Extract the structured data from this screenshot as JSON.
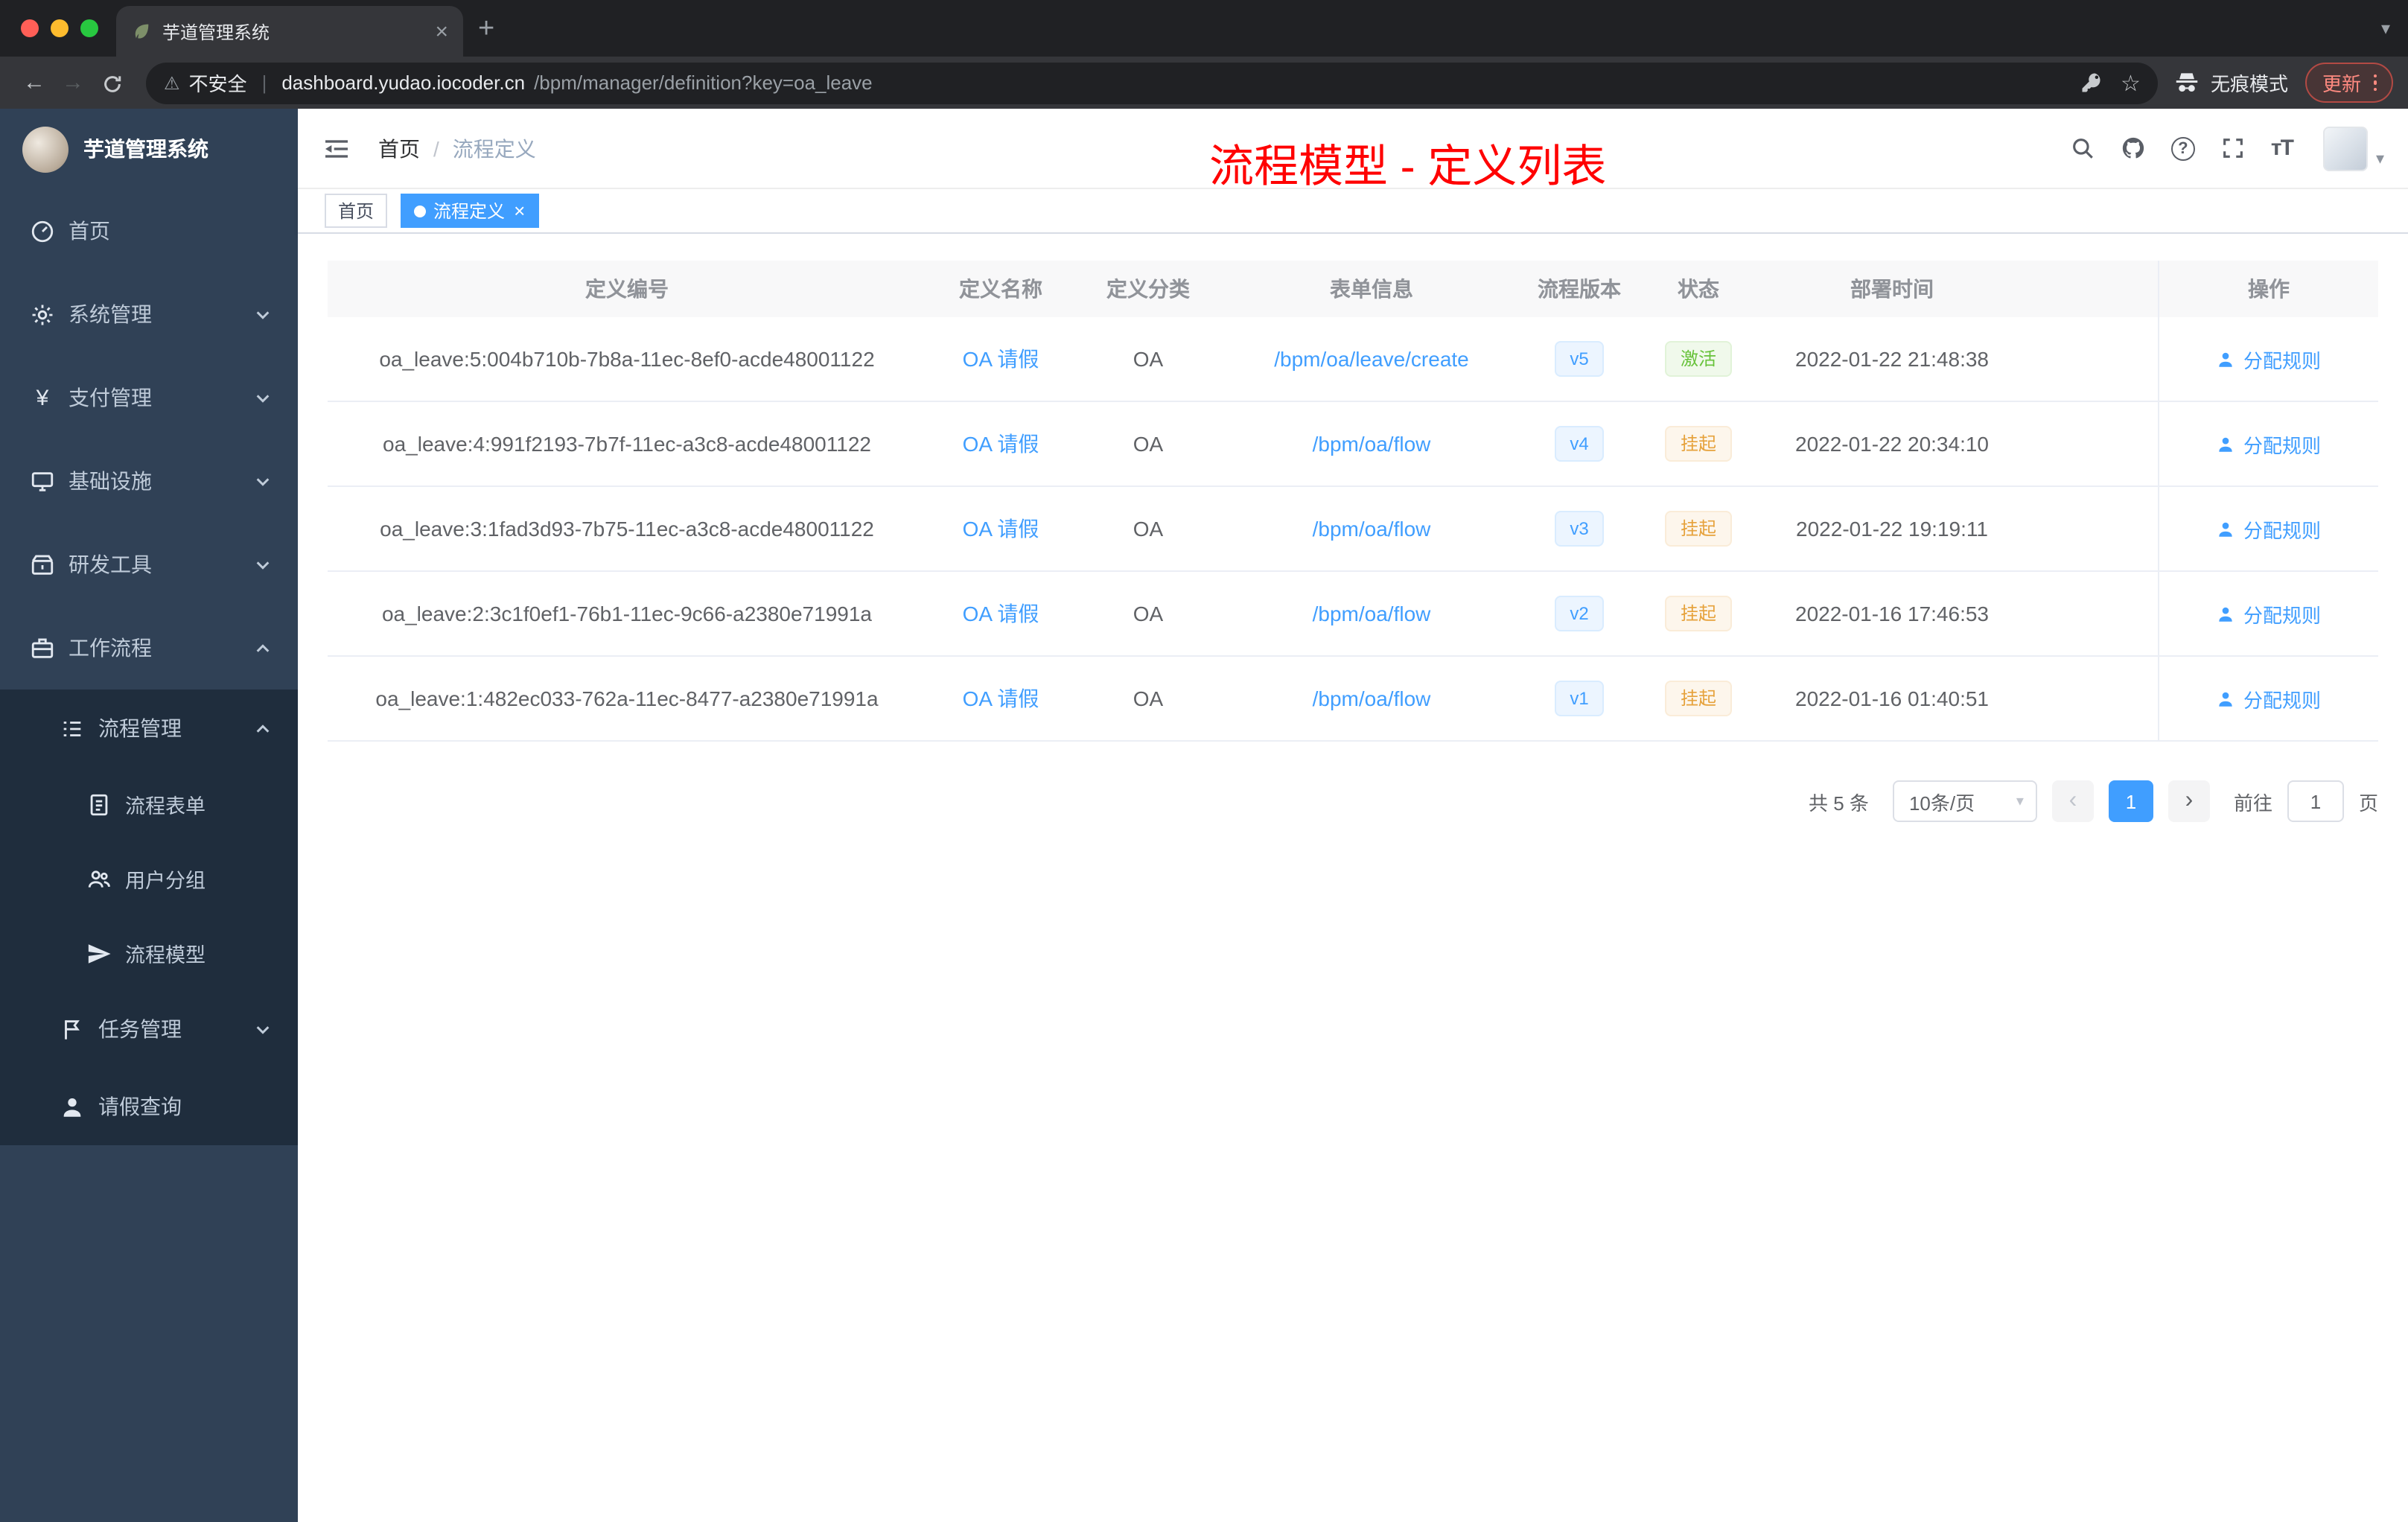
{
  "browser": {
    "tab_title": "芋道管理系统",
    "security_label": "不安全",
    "url_host": "dashboard.yudao.iocoder.cn",
    "url_path": "/bpm/manager/definition?key=oa_leave",
    "incognito_label": "无痕模式",
    "update_label": "更新"
  },
  "sidebar": {
    "brand": "芋道管理系统",
    "items": [
      {
        "label": "首页",
        "icon": "dashboard-icon",
        "chevron": ""
      },
      {
        "label": "系统管理",
        "icon": "gear-icon",
        "chevron": "down"
      },
      {
        "label": "支付管理",
        "icon": "yen-icon",
        "chevron": "down"
      },
      {
        "label": "基础设施",
        "icon": "monitor-icon",
        "chevron": "down"
      },
      {
        "label": "研发工具",
        "icon": "toolbox-icon",
        "chevron": "down"
      },
      {
        "label": "工作流程",
        "icon": "briefcase-icon",
        "chevron": "up"
      },
      {
        "label": "流程管理",
        "icon": "list-icon",
        "chevron": "up"
      },
      {
        "label": "流程表单",
        "icon": "form-icon",
        "chevron": ""
      },
      {
        "label": "用户分组",
        "icon": "users-icon",
        "chevron": ""
      },
      {
        "label": "流程模型",
        "icon": "send-icon",
        "chevron": ""
      },
      {
        "label": "任务管理",
        "icon": "flag-icon",
        "chevron": "down"
      },
      {
        "label": "请假查询",
        "icon": "user-icon",
        "chevron": ""
      }
    ]
  },
  "header": {
    "breadcrumb_home": "首页",
    "breadcrumb_sep": "/",
    "breadcrumb_current": "流程定义",
    "annotation": "流程模型 - 定义列表"
  },
  "tags_view": {
    "tags": [
      {
        "label": "首页",
        "active": false
      },
      {
        "label": "流程定义",
        "active": true
      }
    ]
  },
  "table": {
    "columns": [
      "定义编号",
      "定义名称",
      "定义分类",
      "表单信息",
      "流程版本",
      "状态",
      "部署时间",
      "操作"
    ],
    "rows": [
      {
        "id": "oa_leave:5:004b710b-7b8a-11ec-8ef0-acde48001122",
        "name": "OA 请假",
        "category": "OA",
        "form": "/bpm/oa/leave/create",
        "version": "v5",
        "status": "激活",
        "status_type": "success",
        "time": "2022-01-22 21:48:38",
        "action": "分配规则"
      },
      {
        "id": "oa_leave:4:991f2193-7b7f-11ec-a3c8-acde48001122",
        "name": "OA 请假",
        "category": "OA",
        "form": "/bpm/oa/flow",
        "version": "v4",
        "status": "挂起",
        "status_type": "warning",
        "time": "2022-01-22 20:34:10",
        "action": "分配规则"
      },
      {
        "id": "oa_leave:3:1fad3d93-7b75-11ec-a3c8-acde48001122",
        "name": "OA 请假",
        "category": "OA",
        "form": "/bpm/oa/flow",
        "version": "v3",
        "status": "挂起",
        "status_type": "warning",
        "time": "2022-01-22 19:19:11",
        "action": "分配规则"
      },
      {
        "id": "oa_leave:2:3c1f0ef1-76b1-11ec-9c66-a2380e71991a",
        "name": "OA 请假",
        "category": "OA",
        "form": "/bpm/oa/flow",
        "version": "v2",
        "status": "挂起",
        "status_type": "warning",
        "time": "2022-01-16 17:46:53",
        "action": "分配规则"
      },
      {
        "id": "oa_leave:1:482ec033-762a-11ec-8477-a2380e71991a",
        "name": "OA 请假",
        "category": "OA",
        "form": "/bpm/oa/flow",
        "version": "v1",
        "status": "挂起",
        "status_type": "warning",
        "time": "2022-01-16 01:40:51",
        "action": "分配规则"
      }
    ]
  },
  "pagination": {
    "total": "共 5 条",
    "page_size": "10条/页",
    "current_page": "1",
    "goto_label": "前往",
    "goto_value": "1",
    "page_unit": "页"
  }
}
